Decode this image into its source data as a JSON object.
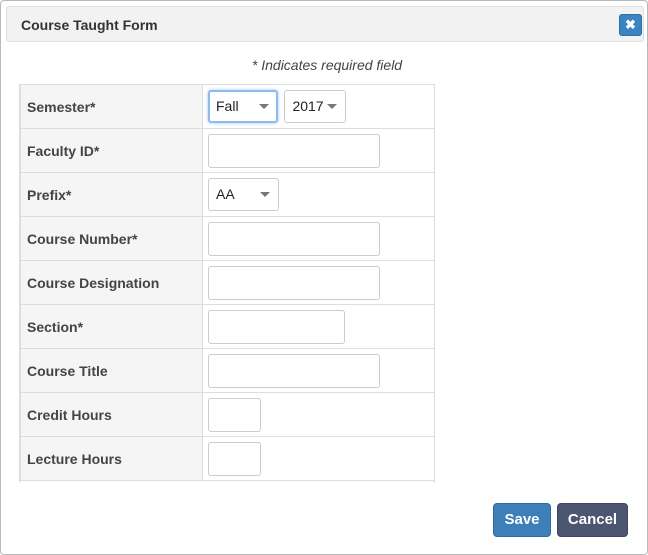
{
  "dialog": {
    "title": "Course Taught Form",
    "close_glyph": "✖"
  },
  "form": {
    "required_note": "* Indicates required field",
    "rows": [
      {
        "label": "Semester*"
      },
      {
        "label": "Faculty ID*",
        "value": ""
      },
      {
        "label": "Prefix*"
      },
      {
        "label": "Course Number*",
        "value": ""
      },
      {
        "label": "Course Designation",
        "value": ""
      },
      {
        "label": "Section*",
        "value": ""
      },
      {
        "label": "Course Title",
        "value": ""
      },
      {
        "label": "Credit Hours",
        "value": ""
      },
      {
        "label": "Lecture Hours",
        "value": ""
      }
    ],
    "semester_term": "Fall",
    "semester_year": "2017",
    "prefix": "AA"
  },
  "buttons": {
    "save": "Save",
    "cancel": "Cancel"
  },
  "colors": {
    "primary": "#3e7fba",
    "secondary": "#4d5670",
    "focus": "#8fbaf0"
  }
}
